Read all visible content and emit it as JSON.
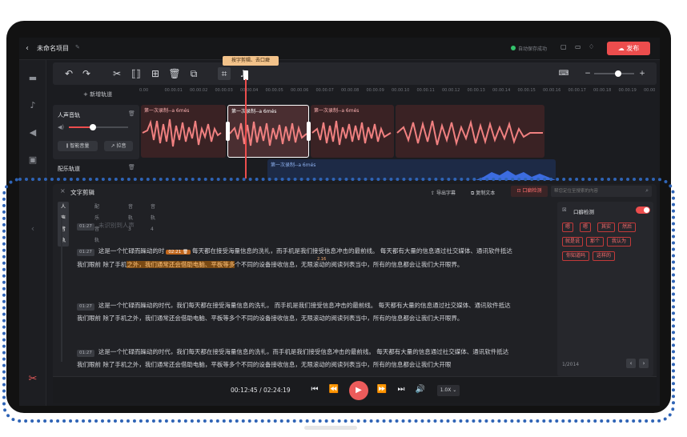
{
  "title": "未命名项目",
  "autosave": "自动保存成功",
  "publish": "发布",
  "tooltip": "按字剪辑、去口癖",
  "add_track": "+ 新增轨道",
  "ruler": [
    "0.00",
    "00.00.01",
    "00.00.02",
    "00.00.03",
    "00.00.04",
    "00.00.05",
    "00.00.06",
    "00.00.07",
    "00.00.08",
    "00.00.09",
    "00.00.10",
    "00.00.11",
    "00.00.12",
    "00.00.13",
    "00.00.14",
    "00.00.15",
    "00.00.16",
    "00.00.17",
    "00.00.18",
    "00.00.19",
    "00.00"
  ],
  "voice_track": {
    "label": "人声音轨",
    "smart_volume": "智能音量",
    "pitch": "拉音"
  },
  "clip_label": "第一次录制--a 6més",
  "bgm_track": {
    "label": "配乐轨道",
    "clip": "第一次录制--a 6més"
  },
  "text_edit": {
    "title": "文字剪辑",
    "export_subtitle": "导出字幕",
    "copy_text": "复制文本",
    "oral_check": "口癖检测",
    "search_placeholder": "帮您定位至搜索的内容",
    "tabs": [
      "人声音轨",
      "配乐音轨",
      "音轨3",
      "音轨4"
    ]
  },
  "paragraphs": [
    {
      "time": "01:27",
      "text": "未识别到人声"
    },
    {
      "time": "01:27",
      "pre": "这是一个忙碌而躁动的时",
      "badge": "02:21",
      "mid": "每天都在接受海量信息的洗礼，而手机是我们接受信息冲击的最前线。 每天都有大量的信息通过社交媒体、通讯软件抵达我们眼前 除了手机",
      "hl1": "之外，我们通常还会借助电脑、平板等多",
      "post": "个不同的设备接收信息，无限滚动的阅读列表当中，所有的信息都会让我们大开眼界。",
      "cursor_time": "2.16"
    },
    {
      "time": "01:27",
      "text": "这是一个忙碌而躁动的时代，我们每天都在接受海量信息的洗礼， 而手机是我们接受信息冲击的最前线。 每天都有大量的信息通过社交媒体、通讯软件抵达我们眼前 除了手机之外，我们通常还会借助电脑、平板等多个不同的设备接收信息，无限滚动的阅读列表当中，所有的信息都会让我们大开眼界。"
    },
    {
      "time": "01:27",
      "text": "这是一个忙碌而躁动的时代，我们每天都在接受海量信息的洗礼，而手机是我们接受信息冲击的最前线。 每天都有大量的信息通过社交媒体、通讯软件抵达我们眼前 除了手机之外，我们通常还会借助电脑，平板等多个不同的设备接收信息，无限滚动的阅读列表当中，所有的信息都会让我们大开眼"
    }
  ],
  "oral_panel": {
    "title": "口癖检测",
    "chips": [
      "嗯",
      "嗯",
      "其实",
      "然后",
      "就是说",
      "那个",
      "我认为",
      "你知道吗",
      "这样的"
    ],
    "page": "1/2014"
  },
  "player": {
    "time": "00:12:45 / 02:24:19",
    "speed": "1.0X"
  }
}
